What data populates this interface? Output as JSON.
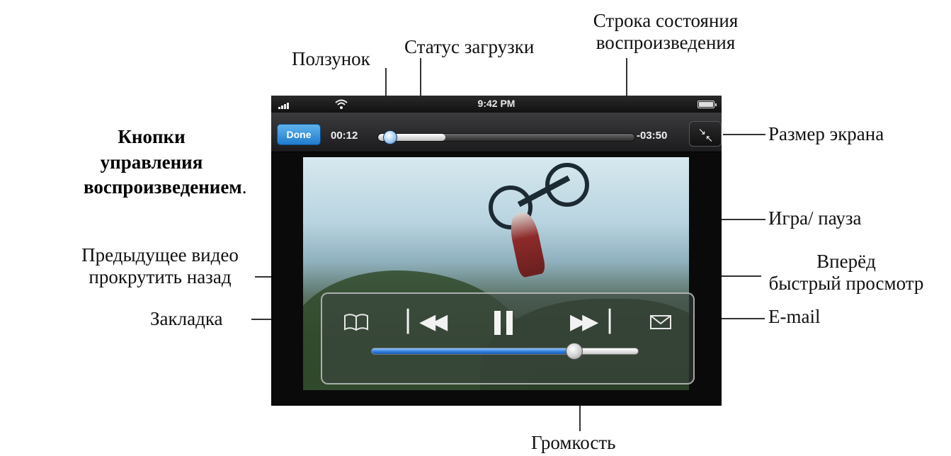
{
  "annotations": {
    "title_bold": "Кнопки управления воспроизведением",
    "title_suffix": ".",
    "slider": "Ползунок",
    "download_status": "Статус загрузки",
    "playback_bar_line1": "Строка состояния",
    "playback_bar_line2": "воспроизведения",
    "screen_size": "Размер экрана",
    "play_pause": "Игра/ пауза",
    "previous_line1": "Предыдущее видео",
    "previous_line2": "прокрутить назад",
    "forward_line1": "Вперёд",
    "forward_line2": "быстрый просмотр",
    "bookmark": "Закладка",
    "email": "E-mail",
    "volume": "Громкость"
  },
  "statusbar": {
    "time": "9:42 PM",
    "icons": [
      "signal-bars-icon",
      "wifi-icon",
      "battery-icon"
    ]
  },
  "toolbar": {
    "done_label": "Done",
    "time_elapsed": "00:12",
    "time_remaining": "-03:50",
    "scale_icon": "arrows-inward-icon"
  },
  "playback": {
    "position_fraction": 0.05,
    "buffered_fraction": 0.26
  },
  "controls": {
    "icons": [
      "bookmark-icon",
      "previous-icon",
      "pause-icon",
      "next-icon",
      "email-icon"
    ],
    "volume_fraction": 0.76
  },
  "colors": {
    "accent_blue": "#2c78d8",
    "done_blue": "#1f7cd0"
  }
}
